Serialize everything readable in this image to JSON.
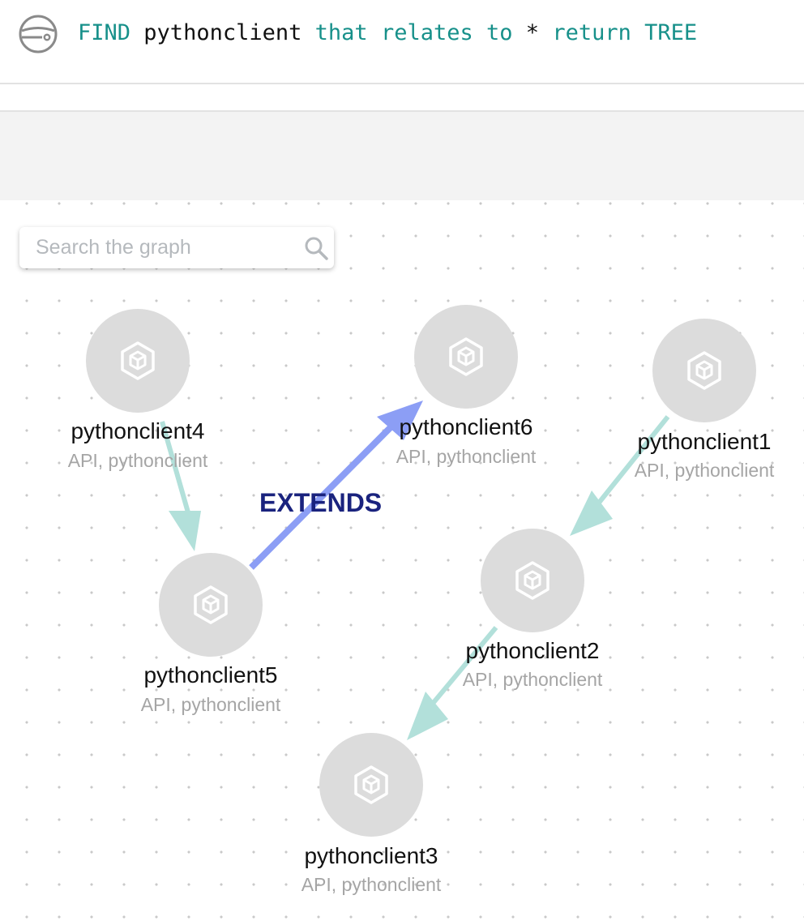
{
  "header": {
    "query_tokens": [
      {
        "text": "FIND",
        "kind": "keyword"
      },
      {
        "text": " ",
        "kind": "space"
      },
      {
        "text": "pythonclient",
        "kind": "value"
      },
      {
        "text": " ",
        "kind": "space"
      },
      {
        "text": "that",
        "kind": "keyword"
      },
      {
        "text": " ",
        "kind": "space"
      },
      {
        "text": "relates",
        "kind": "keyword"
      },
      {
        "text": " ",
        "kind": "space"
      },
      {
        "text": "to",
        "kind": "keyword"
      },
      {
        "text": " ",
        "kind": "space"
      },
      {
        "text": "*",
        "kind": "value"
      },
      {
        "text": " ",
        "kind": "space"
      },
      {
        "text": "return",
        "kind": "keyword"
      },
      {
        "text": " ",
        "kind": "space"
      },
      {
        "text": "TREE",
        "kind": "keyword"
      }
    ]
  },
  "search": {
    "placeholder": "Search the graph",
    "value": ""
  },
  "graph": {
    "nodes": [
      {
        "id": "pythonclient4",
        "name": "pythonclient4",
        "tags": "API, pythonclient"
      },
      {
        "id": "pythonclient6",
        "name": "pythonclient6",
        "tags": "API, pythonclient"
      },
      {
        "id": "pythonclient1",
        "name": "pythonclient1",
        "tags": "API, pythonclient"
      },
      {
        "id": "pythonclient5",
        "name": "pythonclient5",
        "tags": "API, pythonclient"
      },
      {
        "id": "pythonclient2",
        "name": "pythonclient2",
        "tags": "API, pythonclient"
      },
      {
        "id": "pythonclient3",
        "name": "pythonclient3",
        "tags": "API, pythonclient"
      }
    ],
    "edges": [
      {
        "from": "pythonclient4",
        "to": "pythonclient5",
        "label": "",
        "highlighted": false
      },
      {
        "from": "pythonclient1",
        "to": "pythonclient2",
        "label": "",
        "highlighted": false
      },
      {
        "from": "pythonclient2",
        "to": "pythonclient3",
        "label": "",
        "highlighted": false
      },
      {
        "from": "pythonclient5",
        "to": "pythonclient6",
        "label": "EXTENDS",
        "highlighted": true
      }
    ],
    "icons": {
      "node": "cube-hexagon-icon",
      "search": "search-icon",
      "logo": "planet-logo-icon"
    }
  },
  "colors": {
    "keyword": "#17908a",
    "value": "#111111",
    "node_fill": "#dcdcdc",
    "edge": "#b2e0da",
    "edge_highlight": "#8c9ef5",
    "edge_label": "#1a237e",
    "tags": "#a5a5a5"
  }
}
